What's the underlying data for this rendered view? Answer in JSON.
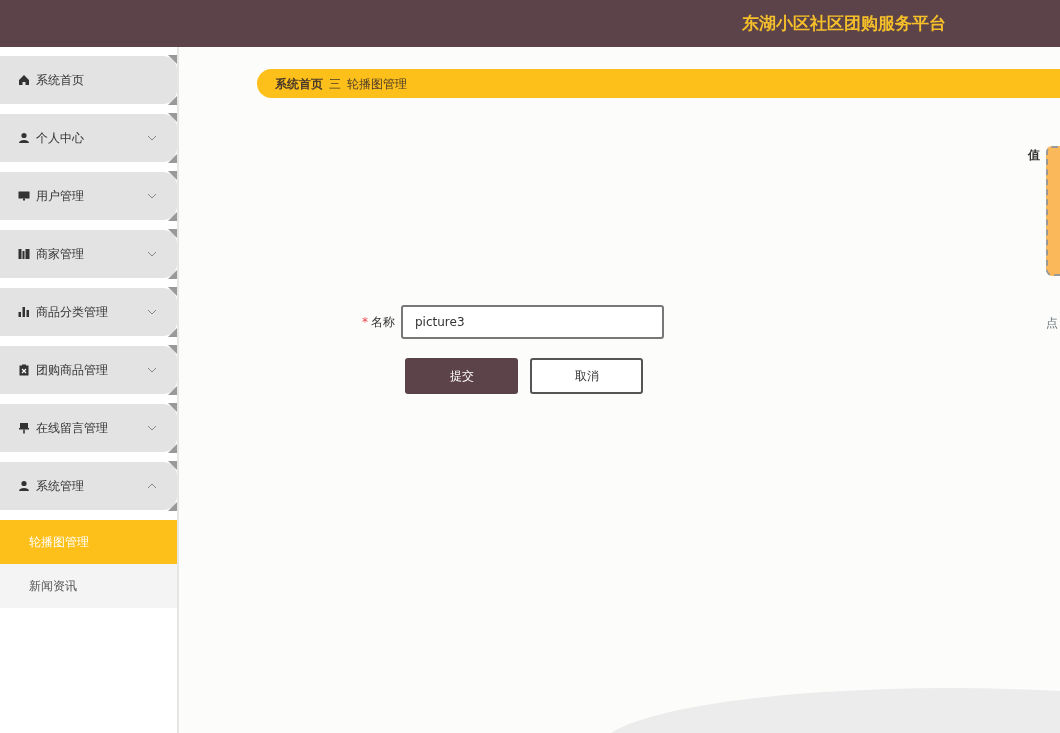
{
  "header": {
    "title": "东湖小区社区团购服务平台"
  },
  "sidebar": {
    "items": [
      {
        "label": "系统首页",
        "kind": "link"
      },
      {
        "label": "个人中心",
        "kind": "menu",
        "expanded": false
      },
      {
        "label": "用户管理",
        "kind": "menu",
        "expanded": false
      },
      {
        "label": "商家管理",
        "kind": "menu",
        "expanded": false
      },
      {
        "label": "商品分类管理",
        "kind": "menu",
        "expanded": false
      },
      {
        "label": "团购商品管理",
        "kind": "menu",
        "expanded": false
      },
      {
        "label": "在线留言管理",
        "kind": "menu",
        "expanded": false
      },
      {
        "label": "系统管理",
        "kind": "menu",
        "expanded": true,
        "children": [
          {
            "label": "轮播图管理",
            "selected": true
          },
          {
            "label": "新闻资讯",
            "selected": false
          }
        ]
      }
    ]
  },
  "breadcrumb": {
    "items": [
      "系统首页",
      "轮播图管理"
    ],
    "separator": "三"
  },
  "form": {
    "fields": [
      {
        "label": "名称",
        "required_mark": "*",
        "value": "picture3"
      }
    ],
    "buttons": [
      {
        "label": "提交",
        "kind": "primary"
      },
      {
        "label": "取消",
        "kind": "secondary"
      }
    ]
  },
  "upload": {
    "label": "值",
    "hint": "点"
  }
}
